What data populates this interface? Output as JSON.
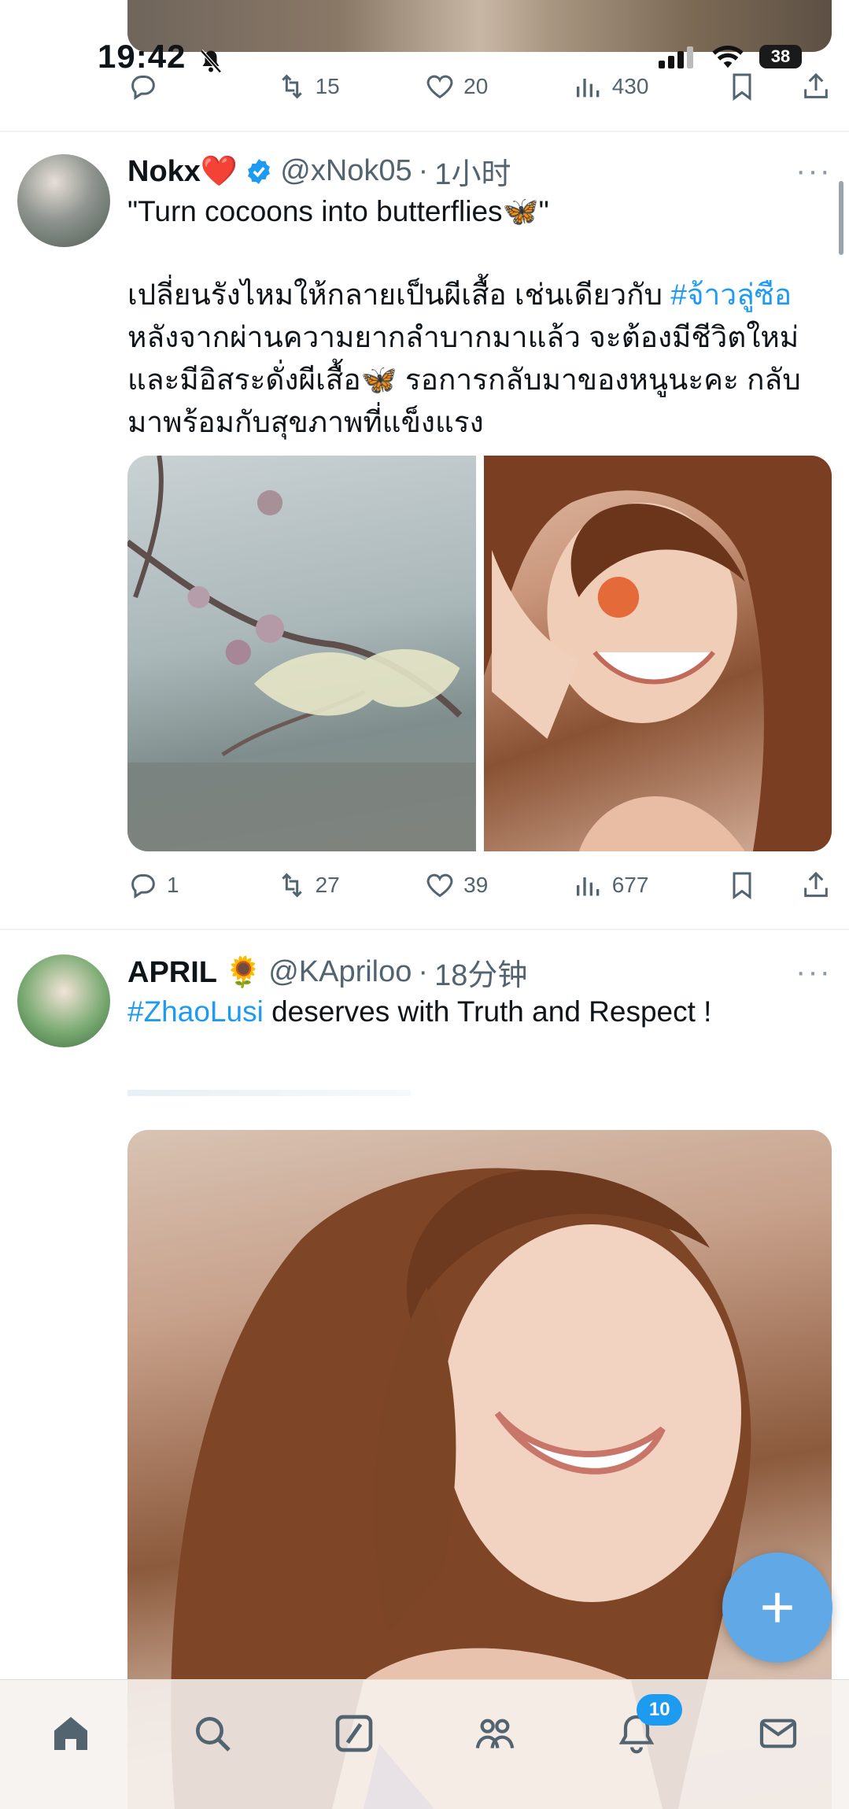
{
  "status_bar": {
    "time": "19:42",
    "battery": "38"
  },
  "prev_tweet": {
    "actions": {
      "replies": "",
      "retweets": "15",
      "likes": "20",
      "views": "430"
    }
  },
  "tweet1": {
    "name": "Nokx❤️",
    "handle": "@xNok05",
    "time": "1小时",
    "line1": "\"Turn cocoons into butterflies🦋\"",
    "thai_part1": "เปลี่ยนรังไหมให้กลายเป็นผีเสื้อ เช่นเดียวกับ ",
    "hashtag": "#จ้าวลู่ซือ",
    "thai_part2": "หลังจากผ่านความยากลำบากมาแล้ว จะต้องมีชีวิตใหม่และมีอิสระดั่งผีเสื้อ🦋 รอการกลับมาของหนูนะคะ กลับมาพร้อมกับสุขภาพที่แข็งแรง",
    "actions": {
      "replies": "1",
      "retweets": "27",
      "likes": "39",
      "views": "677"
    }
  },
  "tweet2": {
    "name": "APRIL 🌻",
    "handle": "@KApriloo",
    "time": "18分钟",
    "hashtag": "#ZhaoLusi",
    "text": " deserves with Truth and Respect !"
  },
  "nav": {
    "notifications_badge": "10"
  },
  "colors": {
    "accent": "#1d9bf0",
    "fab": "#60a9e6",
    "muted": "#536471"
  }
}
